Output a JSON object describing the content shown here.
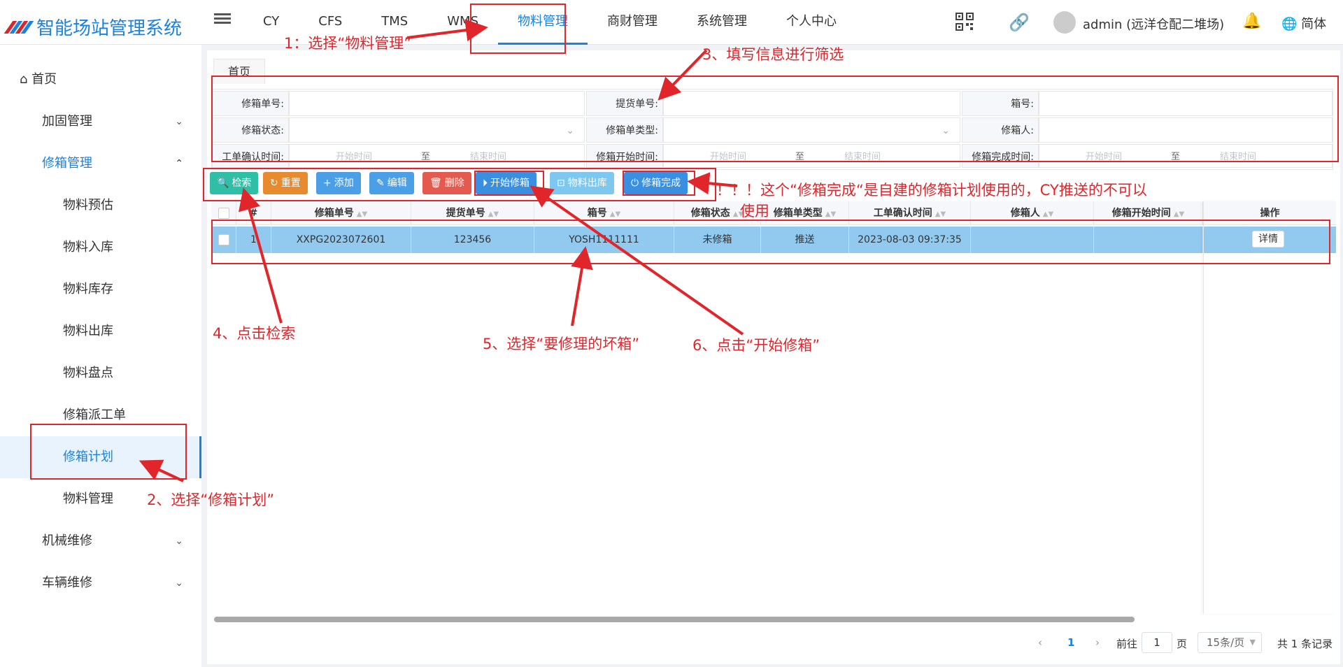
{
  "app_title": "智能场站管理系统",
  "top_nav": [
    "CY",
    "CFS",
    "TMS",
    "WMS",
    "物料管理",
    "商财管理",
    "系统管理",
    "个人中心"
  ],
  "top_nav_active_index": 4,
  "user": {
    "name": "admin (远洋仓配二堆场)",
    "language": "简体"
  },
  "sidebar": {
    "home": "首页",
    "groups": [
      {
        "label": "加固管理",
        "expanded": false
      },
      {
        "label": "修箱管理",
        "expanded": true,
        "children": [
          "物料预估",
          "物料入库",
          "物料库存",
          "物料出库",
          "物料盘点",
          "修箱派工单",
          "修箱计划",
          "物料管理"
        ],
        "active_child": "修箱计划"
      },
      {
        "label": "机械维修",
        "expanded": false
      },
      {
        "label": "车辆维修",
        "expanded": false
      }
    ]
  },
  "page_tab": "首页",
  "filters": {
    "row1": {
      "l1": "修箱单号:",
      "l2": "提货单号:",
      "l3": "箱号:"
    },
    "row2": {
      "l1": "修箱状态:",
      "l2": "修箱单类型:",
      "l3": "修箱人:"
    },
    "row3": {
      "l1": "工单确认时间:",
      "l2": "修箱开始时间:",
      "l3": "修箱完成时间:"
    },
    "start_ph": "开始时间",
    "to": "至",
    "end_ph": "结束时间"
  },
  "toolbar": {
    "search": "检索",
    "reset": "重置",
    "add": "添加",
    "edit": "编辑",
    "delete": "删除",
    "start_repair": "开始修箱",
    "material_out": "物料出库",
    "finish_repair": "修箱完成"
  },
  "table": {
    "headers": [
      "#",
      "修箱单号",
      "提货单号",
      "箱号",
      "修箱状态",
      "修箱单类型",
      "工单确认时间",
      "修箱人",
      "修箱开始时间",
      "操作"
    ],
    "rows": [
      {
        "index": "1",
        "order_no": "XXPG2023072601",
        "bill_no": "123456",
        "box_no": "YOSH1111111",
        "status": "未修箱",
        "type": "推送",
        "confirm_time": "2023-08-03 09:37:35",
        "repairer": "",
        "start_time": "",
        "action": "详情"
      }
    ]
  },
  "pagination": {
    "prev": "‹",
    "page": "1",
    "next": "›",
    "goto_label": "前往",
    "goto_value": "1",
    "page_unit": "页",
    "size": "15条/页",
    "total": "共 1 条记录"
  },
  "annotations": {
    "a1": "1：选择“物料管理”",
    "a2": "2、选择“修箱计划”",
    "a3": "3、填写信息进行筛选",
    "a4": "4、点击检索",
    "a5": "5、选择“要修理的坏箱”",
    "a6": "6、点击“开始修箱”",
    "note_line1": "！！！这个“修箱完成“是自建的修箱计划使用的，CY推送的不可以",
    "note_line2": "使用"
  },
  "colors": {
    "brand": "#1a82e2",
    "annotation": "#e0262b",
    "row_selected": "#92c9ef"
  }
}
